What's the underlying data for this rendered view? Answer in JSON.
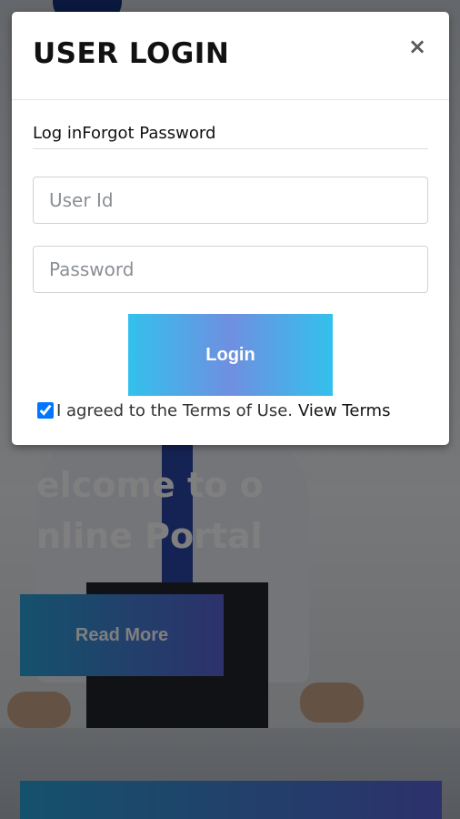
{
  "background": {
    "heading_line1": "elcome to o",
    "heading_line2": "nline Portal",
    "read_more_label": "Read More"
  },
  "modal": {
    "title": "USER LOGIN",
    "close_glyph": "×",
    "tabs": [
      {
        "label": "Log in"
      },
      {
        "label": "Forgot Password"
      }
    ],
    "user_id_placeholder": "User Id",
    "password_placeholder": "Password",
    "login_label": "Login",
    "terms_checked": true,
    "terms_text": "I agreed to the Terms of Use.",
    "terms_link": "View Terms"
  },
  "colors": {
    "button_gradient_start": "#33c1ec",
    "button_gradient_mid": "#6f8fe0",
    "overlay": "rgba(0,0,0,0.5)",
    "tie_blue": "#2a47a8"
  },
  "icons": {
    "close": "close-icon",
    "checkbox": "checkbox-checked-icon"
  }
}
